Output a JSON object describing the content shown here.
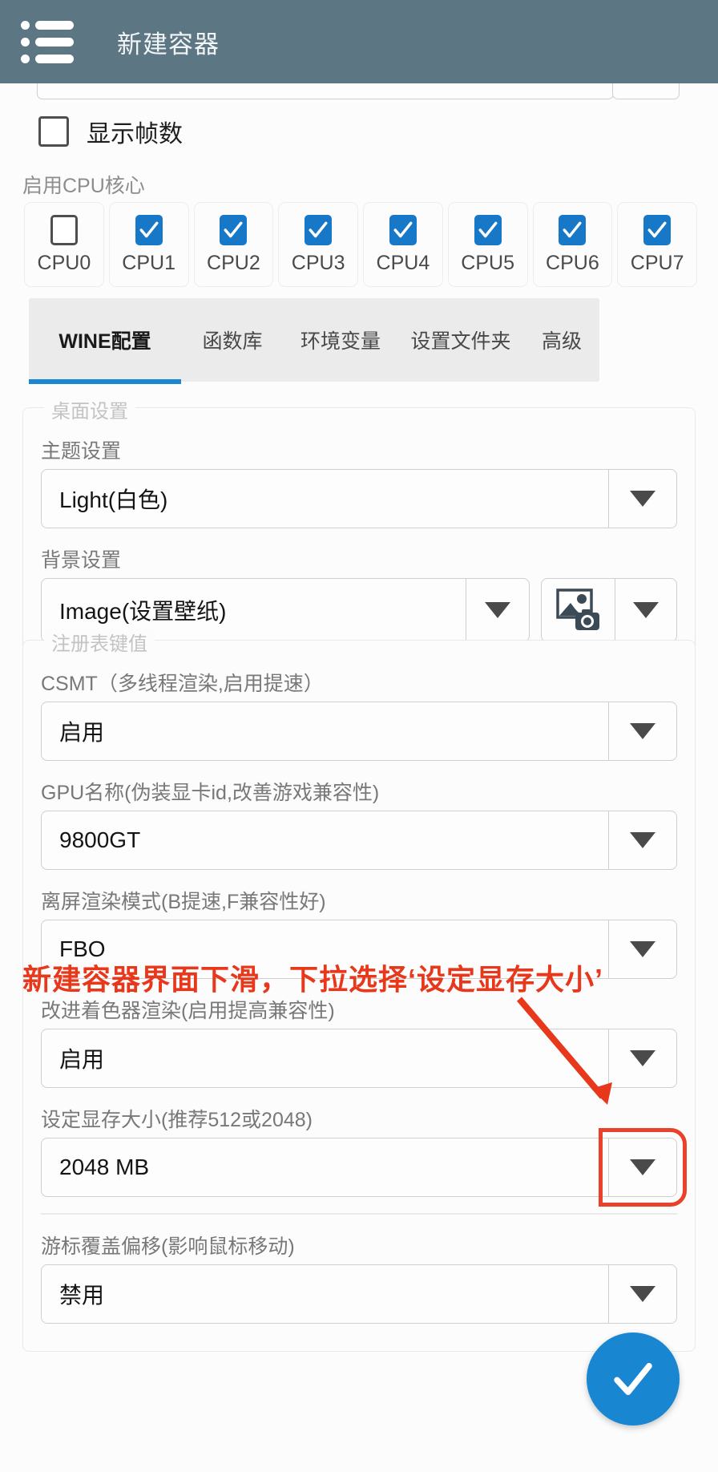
{
  "appbar": {
    "menu_icon": "hamburger-list-icon",
    "title": "新建容器",
    "bg_color": "#5d7684"
  },
  "show_fps": {
    "label": "显示帧数",
    "checked": false
  },
  "cpu_section": {
    "label": "启用CPU核心",
    "cores": [
      {
        "name": "CPU0",
        "checked": false
      },
      {
        "name": "CPU1",
        "checked": true
      },
      {
        "name": "CPU2",
        "checked": true
      },
      {
        "name": "CPU3",
        "checked": true
      },
      {
        "name": "CPU4",
        "checked": true
      },
      {
        "name": "CPU5",
        "checked": true
      },
      {
        "name": "CPU6",
        "checked": true
      },
      {
        "name": "CPU7",
        "checked": true
      }
    ]
  },
  "tabs": {
    "active_index": 0,
    "items": [
      {
        "label": "WINE配置"
      },
      {
        "label": "函数库"
      },
      {
        "label": "环境变量"
      },
      {
        "label": "设置文件夹"
      },
      {
        "label": "高级"
      }
    ],
    "accent": "#1b87d2"
  },
  "desktop_group": {
    "legend": "桌面设置",
    "theme": {
      "label": "主题设置",
      "value": "Light(白色)"
    },
    "background": {
      "label": "背景设置",
      "value": "Image(设置壁纸)",
      "picker_icon": "image-camera-icon"
    }
  },
  "registry_group": {
    "legend": "注册表键值",
    "fields": [
      {
        "label": "CSMT（多线程渲染,启用提速）",
        "value": "启用",
        "highlight": false
      },
      {
        "label": "GPU名称(伪装显卡id,改善游戏兼容性)",
        "value": "9800GT",
        "highlight": false
      },
      {
        "label": "离屏渲染模式(B提速,F兼容性好)",
        "value": "FBO",
        "highlight": false
      },
      {
        "label": "改进着色器渲染(启用提高兼容性)",
        "value": "启用",
        "highlight": false
      },
      {
        "label": "设定显存大小(推荐512或2048)",
        "value": "2048 MB",
        "highlight": true
      },
      {
        "label": "游标覆盖偏移(影响鼠标移动)",
        "value": "禁用",
        "highlight": false
      }
    ]
  },
  "annotation": {
    "text": "新建容器界面下滑，下拉选择‘设定显存大小’",
    "color": "#e8381c",
    "arrow": "red-arrow-pointing-down-right"
  },
  "fab": {
    "icon": "check-icon",
    "color": "#1886d0"
  }
}
